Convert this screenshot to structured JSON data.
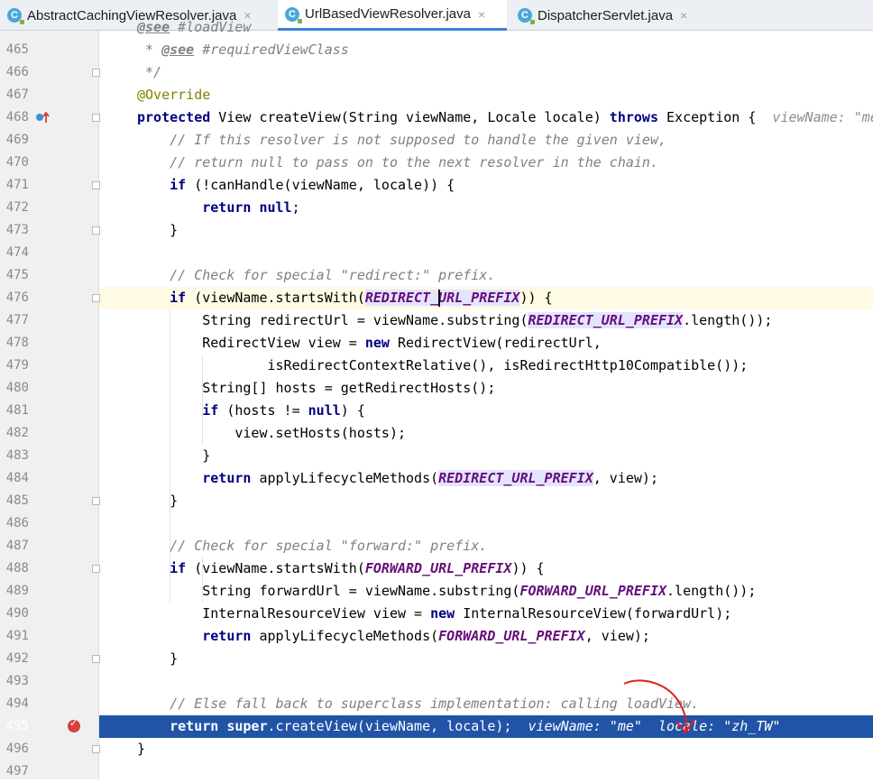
{
  "tabs": [
    {
      "label": "AbstractCachingViewResolver.java",
      "icon": "java-class-icon",
      "active": false
    },
    {
      "label": "UrlBasedViewResolver.java",
      "icon": "java-class-icon",
      "active": true
    },
    {
      "label": "DispatcherServlet.java",
      "icon": "java-class-icon",
      "active": false
    }
  ],
  "tab_icon_letter": "C",
  "close_glyph": "×",
  "colors": {
    "execution_line": "#2154a6",
    "caret_line": "#fffae3",
    "keyword": "#000080",
    "comment": "#808080",
    "constant": "#660e7a",
    "breakpoint": "#d24242"
  },
  "editor": {
    "partial_top_line_text": "@see #loadView",
    "lines": [
      {
        "n": "465",
        "text": " * @see #requiredViewClass"
      },
      {
        "n": "466",
        "text": " */"
      },
      {
        "n": "467",
        "text": "@Override"
      },
      {
        "n": "468",
        "text": "protected View createView(String viewName, Locale locale) throws Exception {",
        "hint": "viewName: \"me"
      },
      {
        "n": "469",
        "text": "    // If this resolver is not supposed to handle the given view,"
      },
      {
        "n": "470",
        "text": "    // return null to pass on to the next resolver in the chain."
      },
      {
        "n": "471",
        "text": "    if (!canHandle(viewName, locale)) {"
      },
      {
        "n": "472",
        "text": "        return null;"
      },
      {
        "n": "473",
        "text": "    }"
      },
      {
        "n": "474",
        "text": ""
      },
      {
        "n": "475",
        "text": "    // Check for special \"redirect:\" prefix."
      },
      {
        "n": "476",
        "text": "    if (viewName.startsWith(REDIRECT_URL_PREFIX)) {"
      },
      {
        "n": "477",
        "text": "        String redirectUrl = viewName.substring(REDIRECT_URL_PREFIX.length());"
      },
      {
        "n": "478",
        "text": "        RedirectView view = new RedirectView(redirectUrl,"
      },
      {
        "n": "479",
        "text": "                isRedirectContextRelative(), isRedirectHttp10Compatible());"
      },
      {
        "n": "480",
        "text": "        String[] hosts = getRedirectHosts();"
      },
      {
        "n": "481",
        "text": "        if (hosts != null) {"
      },
      {
        "n": "482",
        "text": "            view.setHosts(hosts);"
      },
      {
        "n": "483",
        "text": "        }"
      },
      {
        "n": "484",
        "text": "        return applyLifecycleMethods(REDIRECT_URL_PREFIX, view);"
      },
      {
        "n": "485",
        "text": "    }"
      },
      {
        "n": "486",
        "text": ""
      },
      {
        "n": "487",
        "text": "    // Check for special \"forward:\" prefix."
      },
      {
        "n": "488",
        "text": "    if (viewName.startsWith(FORWARD_URL_PREFIX)) {"
      },
      {
        "n": "489",
        "text": "        String forwardUrl = viewName.substring(FORWARD_URL_PREFIX.length());"
      },
      {
        "n": "490",
        "text": "        InternalResourceView view = new InternalResourceView(forwardUrl);"
      },
      {
        "n": "491",
        "text": "        return applyLifecycleMethods(FORWARD_URL_PREFIX, view);"
      },
      {
        "n": "492",
        "text": "    }"
      },
      {
        "n": "493",
        "text": ""
      },
      {
        "n": "494",
        "text": "    // Else fall back to superclass implementation: calling loadView."
      },
      {
        "n": "495",
        "text": "    return super.createView(viewName, locale);",
        "hint": "viewName: \"me\"  locale: \"zh_TW\""
      },
      {
        "n": "496",
        "text": "}"
      },
      {
        "n": "497",
        "text": ""
      }
    ]
  }
}
